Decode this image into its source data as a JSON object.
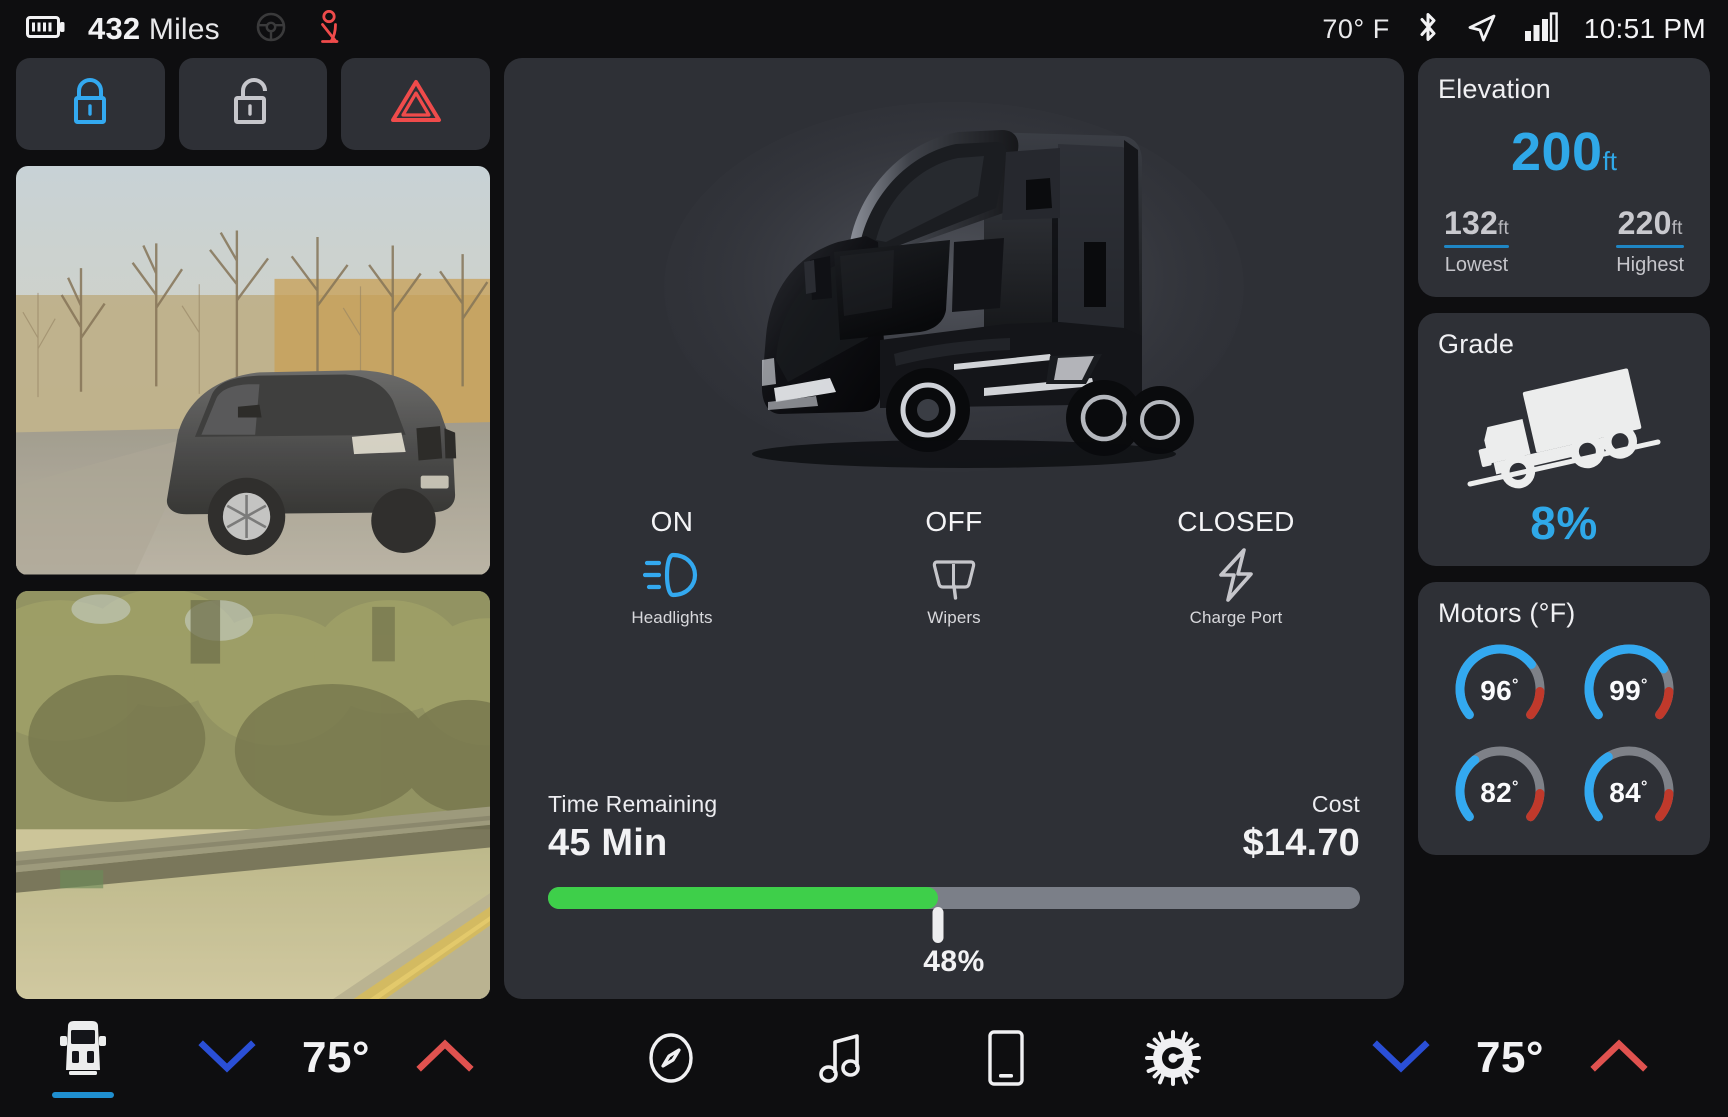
{
  "status_bar": {
    "battery_icon": "battery-icon",
    "range_value": "432",
    "range_unit": "Miles",
    "steering_icon": "steering-wheel-icon",
    "seatbelt_icon": "seatbelt-warning-icon",
    "outside_temp": "70",
    "temp_degree": "°",
    "temp_unit": "F",
    "bluetooth_icon": "bluetooth-icon",
    "location_icon": "navigation-arrow-icon",
    "signal_icon": "cellular-signal-icon",
    "time": "10:51 PM"
  },
  "quick_actions": [
    {
      "name": "lock-button",
      "icon": "lock-closed-icon",
      "state": "active",
      "color": "#33a9f0"
    },
    {
      "name": "unlock-button",
      "icon": "lock-open-icon",
      "state": "inactive",
      "color": "#c6c6cb"
    },
    {
      "name": "hazard-button",
      "icon": "hazard-triangle-icon",
      "state": "inactive",
      "color": "#ef4b4b"
    }
  ],
  "cameras": [
    {
      "name": "camera-feed-front",
      "description": "Dark BMW sedan parked on rural road with bare winter trees"
    },
    {
      "name": "camera-feed-side",
      "description": "Roadside view with guardrail, green trees and yellow lane line"
    }
  ],
  "vehicle": {
    "image_name": "semi-truck-render",
    "description": "Black electric semi truck, three-quarter front view"
  },
  "vehicle_status": [
    {
      "state": "ON",
      "label": "Headlights",
      "icon": "headlight-icon",
      "active": true
    },
    {
      "state": "OFF",
      "label": "Wipers",
      "icon": "wiper-icon",
      "active": false
    },
    {
      "state": "CLOSED",
      "label": "Charge Port",
      "icon": "charge-bolt-icon",
      "active": false
    }
  ],
  "charging": {
    "time_label": "Time Remaining",
    "time_value": "45 Min",
    "cost_label": "Cost",
    "cost_value": "$14.70",
    "percent": 48,
    "percent_text": "48%",
    "fill_color": "#3ecf4a",
    "track_color": "#7b7f88"
  },
  "elevation": {
    "title": "Elevation",
    "current_value": "200",
    "current_unit": "ft",
    "lowest_value": "132",
    "lowest_unit": "ft",
    "lowest_label": "Lowest",
    "highest_value": "220",
    "highest_unit": "ft",
    "highest_label": "Highest",
    "accent_color": "#2fa8e8"
  },
  "grade": {
    "title": "Grade",
    "icon": "truck-on-incline-icon",
    "value": "8%",
    "accent_color": "#2fa8e8"
  },
  "motors": {
    "title": "Motors (°F)",
    "gauges": [
      {
        "name": "motor-gauge-front-left",
        "value": "96",
        "degree": "°",
        "percent": 70
      },
      {
        "name": "motor-gauge-front-right",
        "value": "99",
        "degree": "°",
        "percent": 73
      },
      {
        "name": "motor-gauge-rear-left",
        "value": "82",
        "degree": "°",
        "percent": 35
      },
      {
        "name": "motor-gauge-rear-right",
        "value": "84",
        "degree": "°",
        "percent": 38
      }
    ]
  },
  "bottom_bar": {
    "vehicle_tab": {
      "icon": "truck-front-icon",
      "active": true
    },
    "climate_left": {
      "down_icon": "chevron-down-icon",
      "temp": "75°",
      "up_icon": "chevron-up-icon"
    },
    "climate_right": {
      "down_icon": "chevron-down-icon",
      "temp": "75°",
      "up_icon": "chevron-up-icon"
    },
    "center_icons": [
      {
        "name": "navigation-icon",
        "icon": "compass-icon"
      },
      {
        "name": "media-icon",
        "icon": "music-note-icon"
      },
      {
        "name": "phone-icon",
        "icon": "phone-icon"
      },
      {
        "name": "settings-icon",
        "icon": "gear-icon"
      }
    ],
    "down_color": "#2a4fd6",
    "up_color": "#e0524f",
    "active_underline_color": "#1f8fd0"
  }
}
